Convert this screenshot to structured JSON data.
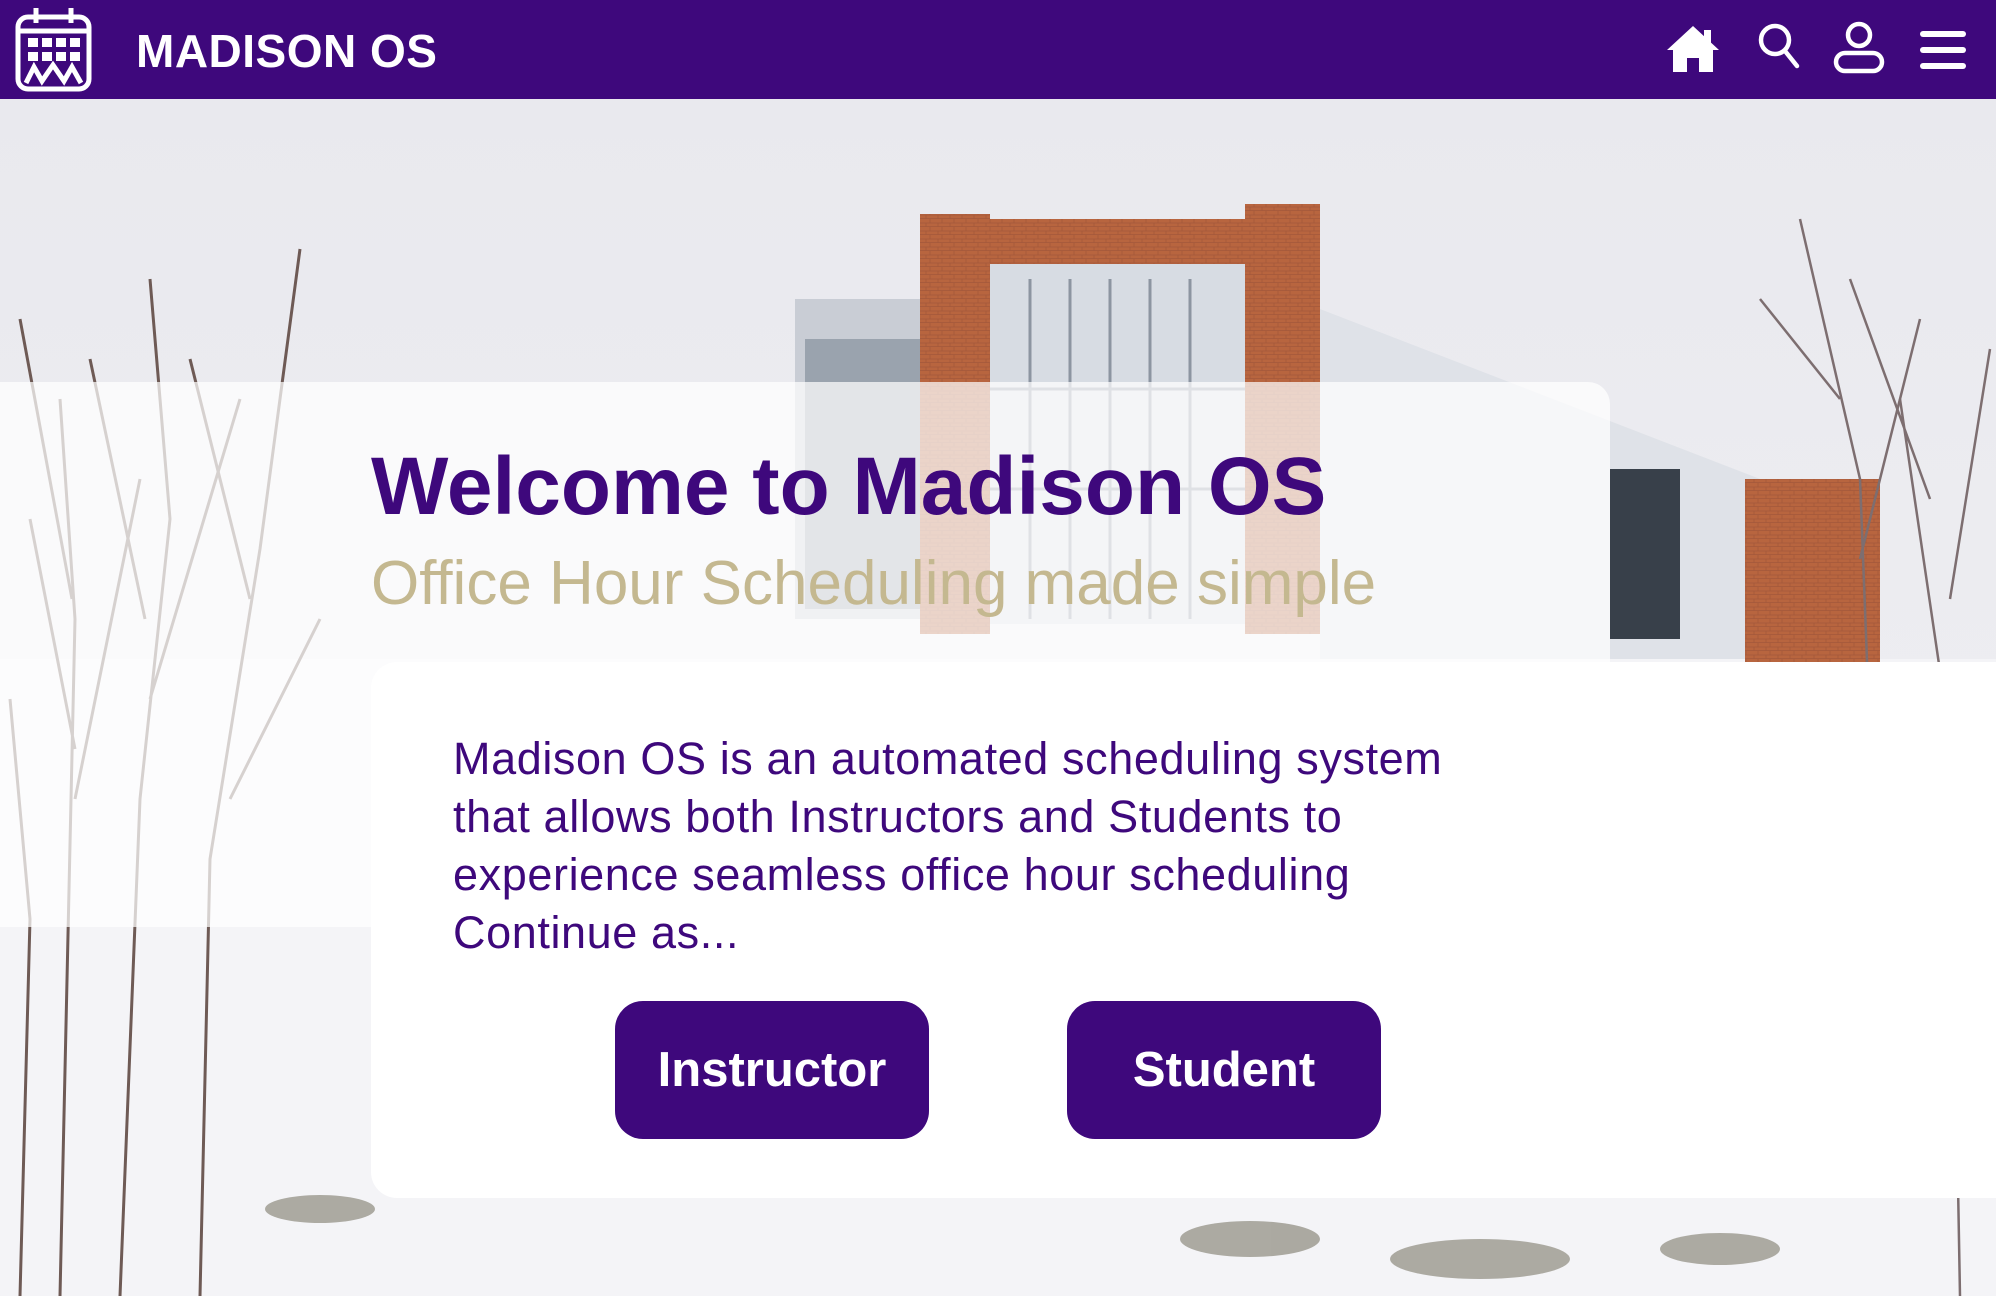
{
  "header": {
    "brand": "MADISON OS",
    "logo_icon": "calendar-icon",
    "nav_icons": [
      "home-icon",
      "search-icon",
      "user-icon",
      "menu-icon"
    ]
  },
  "hero": {
    "title": "Welcome to Madison OS",
    "subtitle": "Office Hour Scheduling made simple"
  },
  "card": {
    "lines": [
      "Madison OS is an automated scheduling system",
      "that allows both Instructors and Students to",
      "experience seamless office hour scheduling",
      "Continue as..."
    ],
    "buttons": {
      "instructor": "Instructor",
      "student": "Student"
    }
  },
  "colors": {
    "primary": "#3e087c",
    "subtitle_gold": "#c4b890",
    "card_bg": "#ffffff"
  }
}
